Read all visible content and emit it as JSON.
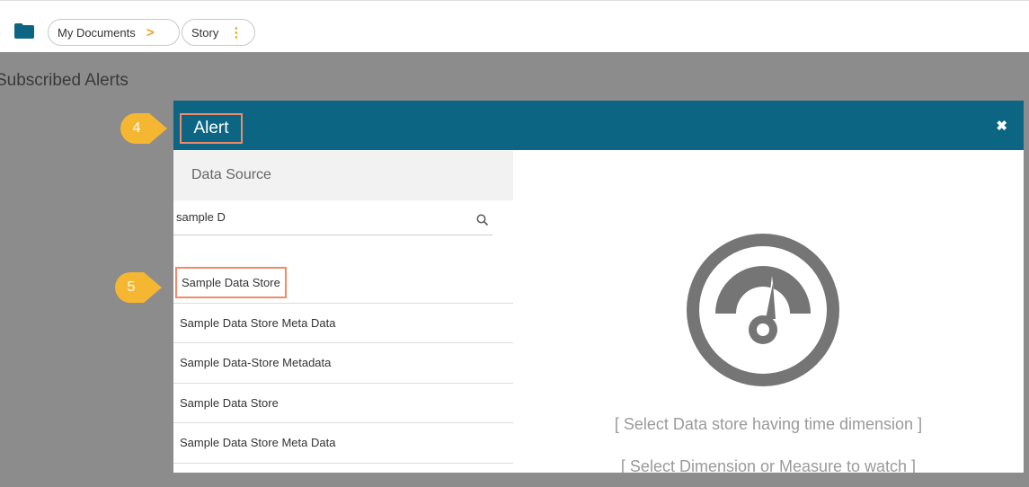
{
  "breadcrumb": {
    "items": [
      {
        "label": "My Documents",
        "separator": ">"
      },
      {
        "label": "Story",
        "menu_glyph": "⋮"
      }
    ]
  },
  "page": {
    "title": "Subscribed Alerts"
  },
  "modal": {
    "title": "Alert",
    "close_glyph": "✖",
    "data_source_label": "Data Source",
    "search": {
      "value": "sample D"
    },
    "data_stores": [
      "Sample Data Store",
      "Sample Data Store Meta Data",
      "Sample Data-Store Metadata",
      "Sample Data Store",
      "Sample Data Store Meta Data"
    ],
    "hint_1": "[ Select Data store having time dimension ]",
    "hint_2": "[ Select Dimension or Measure to watch ]"
  },
  "step_badges": [
    {
      "label": "4"
    },
    {
      "label": "5"
    }
  ],
  "colors": {
    "header": "#0b6583",
    "badge": "#f5b731",
    "highlight": "#ef8a6a",
    "overlay": "#8c8c8c",
    "accent": "#f0a020",
    "gauge": "#757575"
  },
  "icons": [
    "folder-icon",
    "chevron-right-icon",
    "kebab-menu-icon",
    "close-icon",
    "search-icon",
    "gauge-icon"
  ]
}
